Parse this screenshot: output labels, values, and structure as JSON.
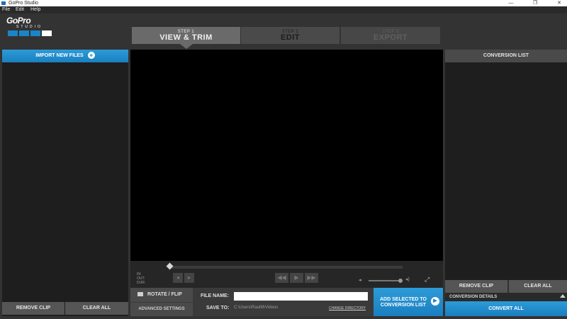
{
  "window": {
    "title": "GoPro Studio",
    "minimize": "—",
    "maximize": "❐",
    "close": "✕"
  },
  "menu": {
    "file": "File",
    "edit": "Edit",
    "help": "Help"
  },
  "logo": {
    "word": "GoPro",
    "studio": "STUDIO"
  },
  "steps": [
    {
      "num": "STEP 1",
      "label": "VIEW & TRIM",
      "active": true
    },
    {
      "num": "STEP 2",
      "label": "EDIT",
      "active": false
    },
    {
      "num": "STEP 3",
      "label": "EXPORT",
      "active": false
    }
  ],
  "left": {
    "import_label": "IMPORT NEW FILES",
    "remove_clip": "REMOVE CLIP",
    "clear_all": "CLEAR ALL"
  },
  "player": {
    "in": "IN:",
    "out": "OUT:",
    "dur": "DUR:"
  },
  "bottom": {
    "rotate_label": "ROTATE / FLIP",
    "advanced_label": "ADVANCED SETTINGS",
    "file_name_label": "FILE NAME:",
    "file_name_value": "",
    "save_to_label": "SAVE TO:",
    "save_path": "C:\\Users\\RaulM\\Videos",
    "change_directory": "CHANGE DIRECTORY",
    "add_selected_line1": "ADD SELECTED TO",
    "add_selected_line2": "CONVERSION LIST"
  },
  "right": {
    "header": "CONVERSION LIST",
    "remove_clip": "REMOVE CLIP",
    "clear_all": "CLEAR ALL",
    "details": "CONVERSION DETAILS",
    "convert_all": "CONVERT ALL"
  },
  "colors": {
    "accent": "#1a86c8",
    "background": "#333333"
  }
}
